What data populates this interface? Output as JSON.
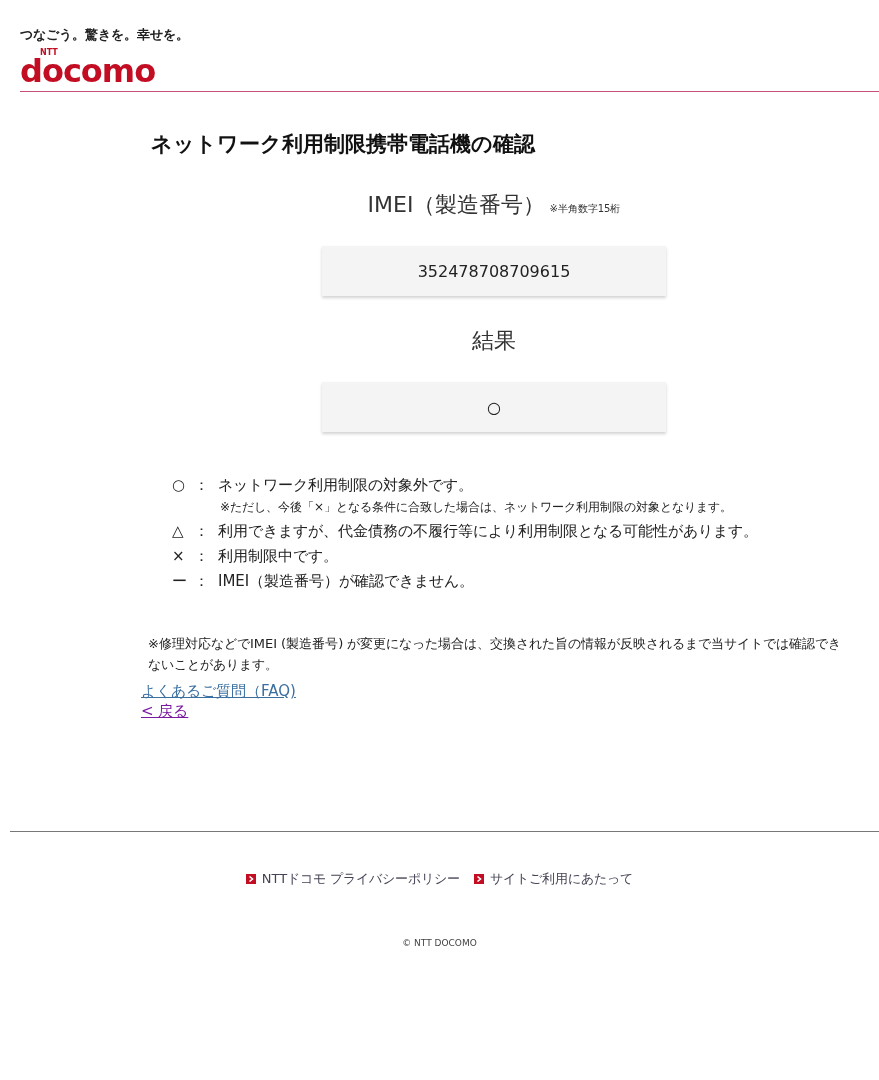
{
  "header": {
    "tagline": "つなごう。驚きを。幸せを。",
    "logo_top": "NTT",
    "logo": "docomo"
  },
  "title": "ネットワーク利用制限携帯電話機の確認",
  "imei": {
    "label": "IMEI（製造番号）",
    "note": "※半角数字15桁",
    "value": "352478708709615"
  },
  "result": {
    "label": "結果",
    "value": "○"
  },
  "legend": [
    {
      "symbol": "○",
      "sep": "：",
      "text": "ネットワーク利用制限の対象外です。",
      "note": "※ただし、今後「×」となる条件に合致した場合は、ネットワーク利用制限の対象となります。"
    },
    {
      "symbol": "△",
      "sep": "：",
      "text": "利用できますが、代金債務の不履行等により利用制限となる可能性があります。"
    },
    {
      "symbol": "×",
      "sep": "：",
      "text": "利用制限中です。"
    },
    {
      "symbol": "ー",
      "sep": "：",
      "text": "IMEI（製造番号）が確認できません。"
    }
  ],
  "notice": "※修理対応などでIMEI (製造番号) が変更になった場合は、交換された旨の情報が反映されるまで当サイトでは確認できないことがあります。",
  "links": [
    {
      "text": "よくあるご質問（FAQ)",
      "visited": false
    },
    {
      "text": "< 戻る",
      "visited": true
    }
  ],
  "footer": {
    "links": [
      "NTTドコモ プライバシーポリシー",
      "サイトご利用にあたって"
    ],
    "copyright": "© NTT DOCOMO"
  }
}
